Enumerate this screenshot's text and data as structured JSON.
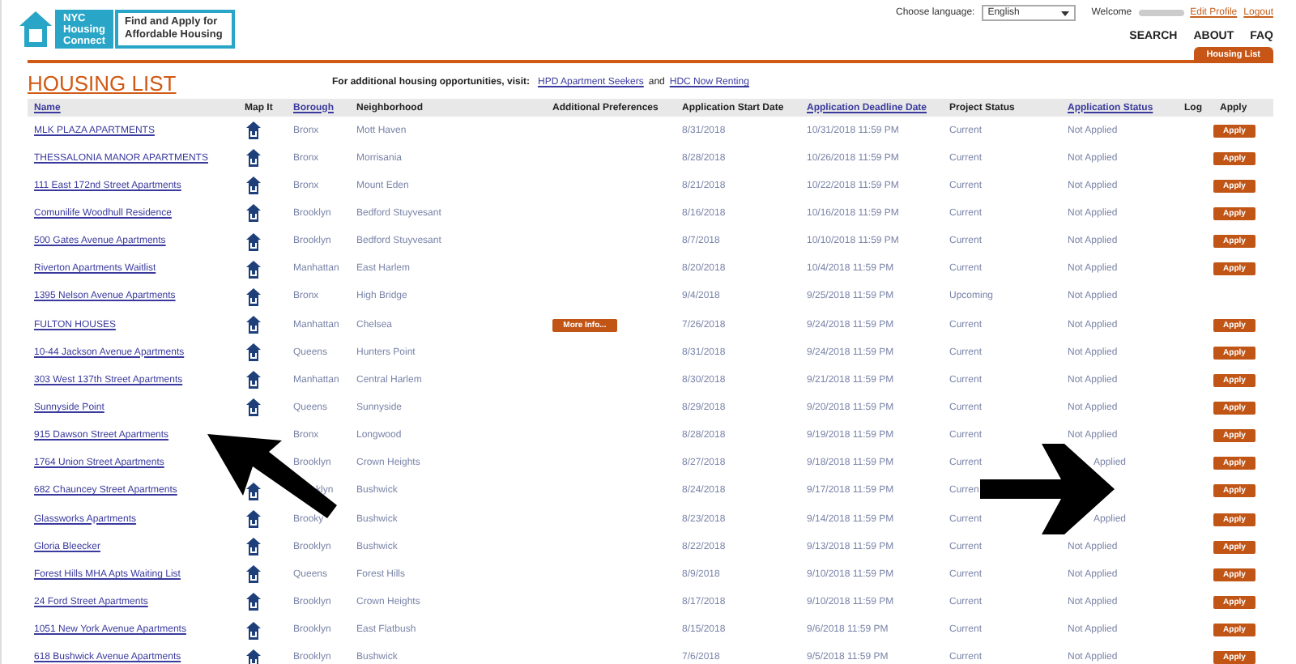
{
  "logo": {
    "name_lines": [
      "NYC",
      "Housing",
      "Connect"
    ],
    "tagline_lines": [
      "Find and Apply for",
      "Affordable Housing"
    ]
  },
  "top": {
    "language_label": "Choose language:",
    "language": "English",
    "welcome": "Welcome",
    "links": [
      "Edit Profile",
      "Logout"
    ]
  },
  "nav": [
    "SEARCH",
    "ABOUT",
    "FAQ"
  ],
  "tabs": [
    {
      "label": "Housing List",
      "selected": true
    }
  ],
  "title": "HOUSING LIST",
  "notice": {
    "text": "For additional housing opportunities, visit:",
    "link1": "HPD Apartment Seekers",
    "joiner": "and",
    "link2": "HDC Now Renting"
  },
  "table": {
    "columns": [
      {
        "label": "Name",
        "sortable": true
      },
      {
        "label": "Map It",
        "sortable": false
      },
      {
        "label": "Borough",
        "sortable": true
      },
      {
        "label": "Neighborhood",
        "sortable": false
      },
      {
        "label": "Additional Preferences",
        "sortable": false
      },
      {
        "label": "Application Start Date",
        "sortable": false
      },
      {
        "label": "Application Deadline Date",
        "sortable": true
      },
      {
        "label": "Project Status",
        "sortable": false
      },
      {
        "label": "Application Status",
        "sortable": true
      },
      {
        "label": "Log",
        "sortable": false
      },
      {
        "label": "Apply",
        "sortable": false
      }
    ],
    "rows": [
      {
        "name": "MLK PLAZA APARTMENTS",
        "borough": "Bronx",
        "neighborhood": "Mott Haven",
        "start": "8/31/2018",
        "deadline": "10/31/2018 11:59 PM",
        "project_status": "Current",
        "application_status": "Not Applied",
        "apply": "Apply"
      },
      {
        "name": "THESSALONIA MANOR APARTMENTS",
        "borough": "Bronx",
        "neighborhood": "Morrisania",
        "start": "8/28/2018",
        "deadline": "10/26/2018 11:59 PM",
        "project_status": "Current",
        "application_status": "Not Applied",
        "apply": "Apply"
      },
      {
        "name": "111 East 172nd Street Apartments",
        "borough": "Bronx",
        "neighborhood": "Mount Eden",
        "start": "8/21/2018",
        "deadline": "10/22/2018 11:59 PM",
        "project_status": "Current",
        "application_status": "Not Applied",
        "apply": "Apply"
      },
      {
        "name": "Comunilife Woodhull Residence",
        "borough": "Brooklyn",
        "neighborhood": "Bedford Stuyvesant",
        "start": "8/16/2018",
        "deadline": "10/16/2018 11:59 PM",
        "project_status": "Current",
        "application_status": "Not Applied",
        "apply": "Apply"
      },
      {
        "name": "500 Gates Avenue Apartments",
        "borough": "Brooklyn",
        "neighborhood": "Bedford Stuyvesant",
        "start": "8/7/2018",
        "deadline": "10/10/2018 11:59 PM",
        "project_status": "Current",
        "application_status": "Not Applied",
        "apply": "Apply"
      },
      {
        "name": "Riverton Apartments Waitlist",
        "borough": "Manhattan",
        "neighborhood": "East Harlem",
        "start": "8/20/2018",
        "deadline": "10/4/2018 11:59 PM",
        "project_status": "Current",
        "application_status": "Not Applied",
        "apply": "Apply"
      },
      {
        "name": "1395 Nelson Avenue Apartments",
        "borough": "Bronx",
        "neighborhood": "High Bridge",
        "start": "9/4/2018",
        "deadline": "9/25/2018 11:59 PM",
        "project_status": "Upcoming",
        "application_status": "Not Applied"
      },
      {
        "name": "FULTON HOUSES",
        "borough": "Manhattan",
        "neighborhood": "Chelsea",
        "more_info": "More Info...",
        "start": "7/26/2018",
        "deadline": "9/24/2018 11:59 PM",
        "project_status": "Current",
        "application_status": "Not Applied",
        "apply": "Apply"
      },
      {
        "name": "10-44 Jackson Avenue Apartments",
        "borough": "Queens",
        "neighborhood": "Hunters Point",
        "start": "8/31/2018",
        "deadline": "9/24/2018 11:59 PM",
        "project_status": "Current",
        "application_status": "Not Applied",
        "apply": "Apply"
      },
      {
        "name": "303 West 137th Street Apartments",
        "borough": "Manhattan",
        "neighborhood": "Central Harlem",
        "start": "8/30/2018",
        "deadline": "9/21/2018 11:59 PM",
        "project_status": "Current",
        "application_status": "Not Applied",
        "apply": "Apply"
      },
      {
        "name": "Sunnyside Point",
        "borough": "Queens",
        "neighborhood": "Sunnyside",
        "start": "8/29/2018",
        "deadline": "9/20/2018 11:59 PM",
        "project_status": "Current",
        "application_status": "Not Applied",
        "apply": "Apply"
      },
      {
        "name": "915 Dawson Street Apartments",
        "map_covered": true,
        "borough": "Bronx",
        "neighborhood": "Longwood",
        "start": "8/28/2018",
        "deadline": "9/19/2018 11:59 PM",
        "project_status": "Current",
        "application_status": "Not Applied",
        "apply": "Apply"
      },
      {
        "name": "1764 Union Street Apartments",
        "map_covered": true,
        "borough": "Brooklyn",
        "neighborhood": "Crown Heights",
        "start": "8/27/2018",
        "deadline": "9/18/2018 11:59 PM",
        "project_status": "Current",
        "application_status": "Applied",
        "apply": "Apply"
      },
      {
        "name": "682 Chauncey Street Apartments",
        "borough": "klyn",
        "neighborhood": "Bushwick",
        "start": "8/24/2018",
        "deadline": "9/17/2018 11:59 PM",
        "project_status": "Curren",
        "apply": "Apply"
      },
      {
        "name": "Glassworks Apartments",
        "borough": "Brooky",
        "neighborhood": "Bushwick",
        "start": "8/23/2018",
        "deadline": "9/14/2018 11:59 PM",
        "project_status": "Current",
        "application_status": "Applied",
        "apply": "Apply"
      },
      {
        "name": "Gloria Bleecker",
        "borough": "Brooklyn",
        "neighborhood": "Bushwick",
        "start": "8/22/2018",
        "deadline": "9/13/2018 11:59 PM",
        "project_status": "Current",
        "application_status": "Not Applied",
        "apply": "Apply"
      },
      {
        "name": "Forest Hills MHA Apts Waiting List",
        "borough": "Queens",
        "neighborhood": "Forest Hills",
        "start": "8/9/2018",
        "deadline": "9/10/2018 11:59 PM",
        "project_status": "Current",
        "application_status": "Not Applied",
        "apply": "Apply"
      },
      {
        "name": "24 Ford Street Apartments",
        "borough": "Brooklyn",
        "neighborhood": "Crown Heights",
        "start": "8/17/2018",
        "deadline": "9/10/2018 11:59 PM",
        "project_status": "Current",
        "application_status": "Not Applied",
        "apply": "Apply"
      },
      {
        "name": "1051 New York Avenue Apartments",
        "borough": "Brooklyn",
        "neighborhood": "East Flatbush",
        "start": "8/15/2018",
        "deadline": "9/6/2018 11:59 PM",
        "project_status": "Current",
        "application_status": "Not Applied",
        "apply": "Apply"
      },
      {
        "name": "618 Bushwick Avenue Apartments",
        "borough": "Brooklyn",
        "neighborhood": "Bushwick",
        "start": "7/6/2018",
        "deadline": "9/5/2018 11:59 PM",
        "project_status": "Current",
        "application_status": "Not Applied",
        "apply": "Apply"
      }
    ]
  }
}
